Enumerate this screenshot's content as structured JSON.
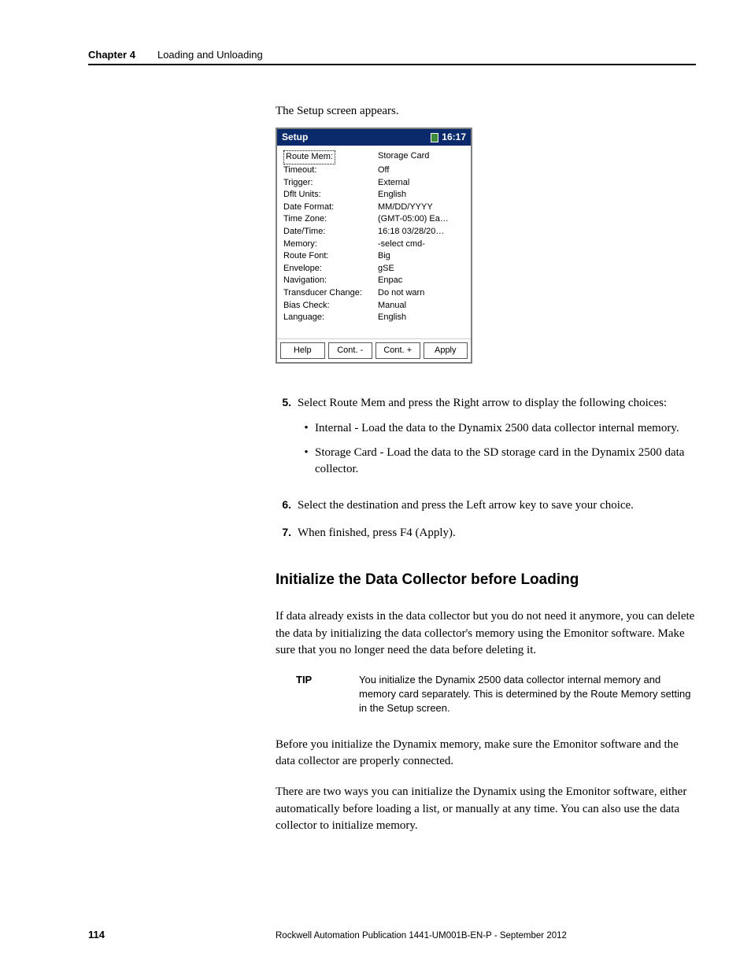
{
  "header": {
    "chapter_label": "Chapter 4",
    "chapter_title": "Loading and Unloading"
  },
  "lead_text": "The Setup screen appears.",
  "device": {
    "title": "Setup",
    "clock": "16:17",
    "rows": [
      {
        "k": "Route Mem:",
        "v": "Storage Card",
        "selected": true
      },
      {
        "k": "Timeout:",
        "v": "Off"
      },
      {
        "k": "Trigger:",
        "v": "External"
      },
      {
        "k": "Dflt Units:",
        "v": "English"
      },
      {
        "k": "Date Format:",
        "v": "MM/DD/YYYY"
      },
      {
        "k": "Time Zone:",
        "v": "(GMT-05:00) Ea…"
      },
      {
        "k": "Date/Time:",
        "v": "16:18 03/28/20…"
      },
      {
        "k": "Memory:",
        "v": "-select cmd-"
      },
      {
        "k": "Route Font:",
        "v": "Big"
      },
      {
        "k": "Envelope:",
        "v": "gSE"
      },
      {
        "k": "Navigation:",
        "v": "Enpac"
      },
      {
        "k": "Transducer Change:",
        "v": "Do not warn"
      },
      {
        "k": "Bias Check:",
        "v": "Manual"
      },
      {
        "k": "Language:",
        "v": "English"
      }
    ],
    "buttons": [
      "Help",
      "Cont. -",
      "Cont. +",
      "Apply"
    ]
  },
  "steps": {
    "s5": {
      "num": "5.",
      "text": "Select Route Mem and press the Right arrow to display the following choices:",
      "bullets": [
        "Internal - Load the data to the Dynamix 2500 data collector internal memory.",
        "Storage Card - Load the data to the SD storage card in the Dynamix 2500 data collector."
      ]
    },
    "s6": {
      "num": "6.",
      "text": "Select the destination and press the Left arrow key to save your choice."
    },
    "s7": {
      "num": "7.",
      "text": "When finished, press F4 (Apply)."
    }
  },
  "h2": "Initialize the Data Collector before Loading",
  "para1": "If data already exists in the data collector but you do not need it anymore, you can delete the data by initializing the data collector's memory using the Emonitor software. Make sure that you no longer need the data before deleting it.",
  "tip": {
    "label": "TIP",
    "text": "You initialize the Dynamix 2500 data collector internal memory and memory card separately. This is determined by the Route Memory setting in the Setup screen."
  },
  "para2": "Before you initialize the Dynamix memory, make sure the Emonitor software and the data collector are properly connected.",
  "para3": "There are two ways you can initialize the Dynamix using the Emonitor software, either automatically before loading a list, or manually at any time. You can also use the data collector to initialize memory.",
  "footer": {
    "page": "114",
    "pub": "Rockwell Automation Publication 1441-UM001B-EN-P - September 2012"
  }
}
